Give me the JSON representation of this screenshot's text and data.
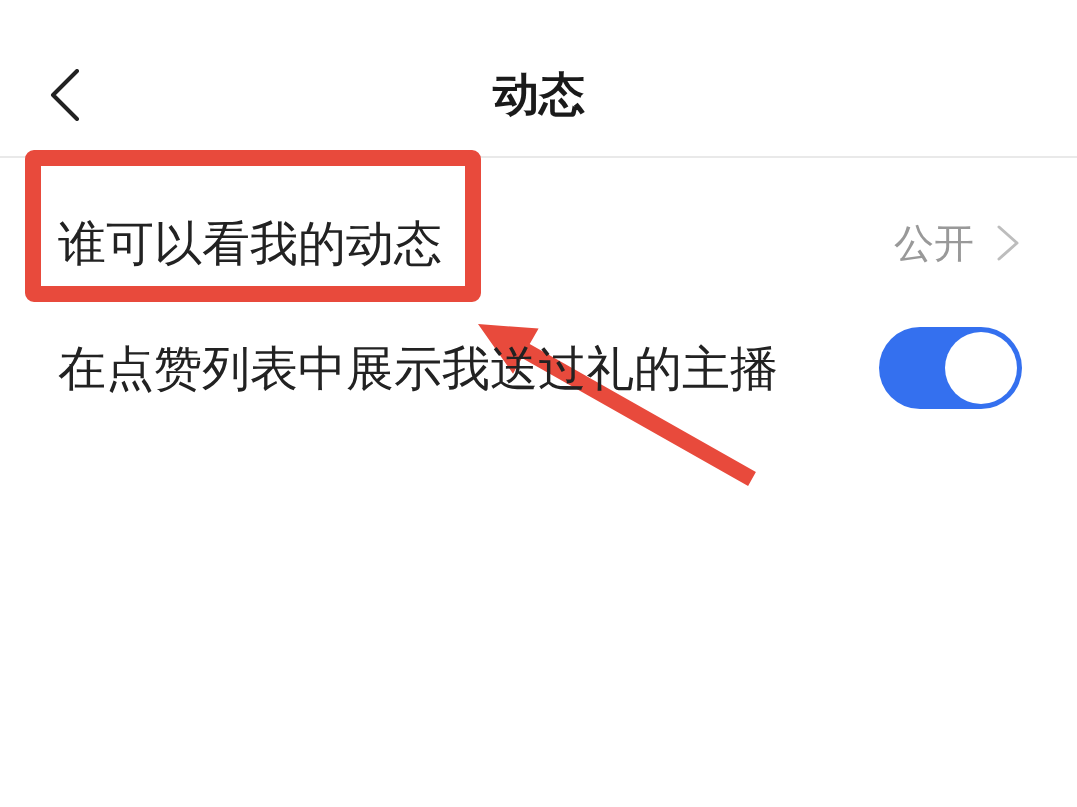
{
  "header": {
    "title": "动态"
  },
  "settings": [
    {
      "kind": "link",
      "label": "谁可以看我的动态",
      "value": "公开",
      "highlighted": true
    },
    {
      "kind": "toggle",
      "label": "在点赞列表中展示我送过礼的主播",
      "on": true,
      "highlighted": false
    }
  ]
}
